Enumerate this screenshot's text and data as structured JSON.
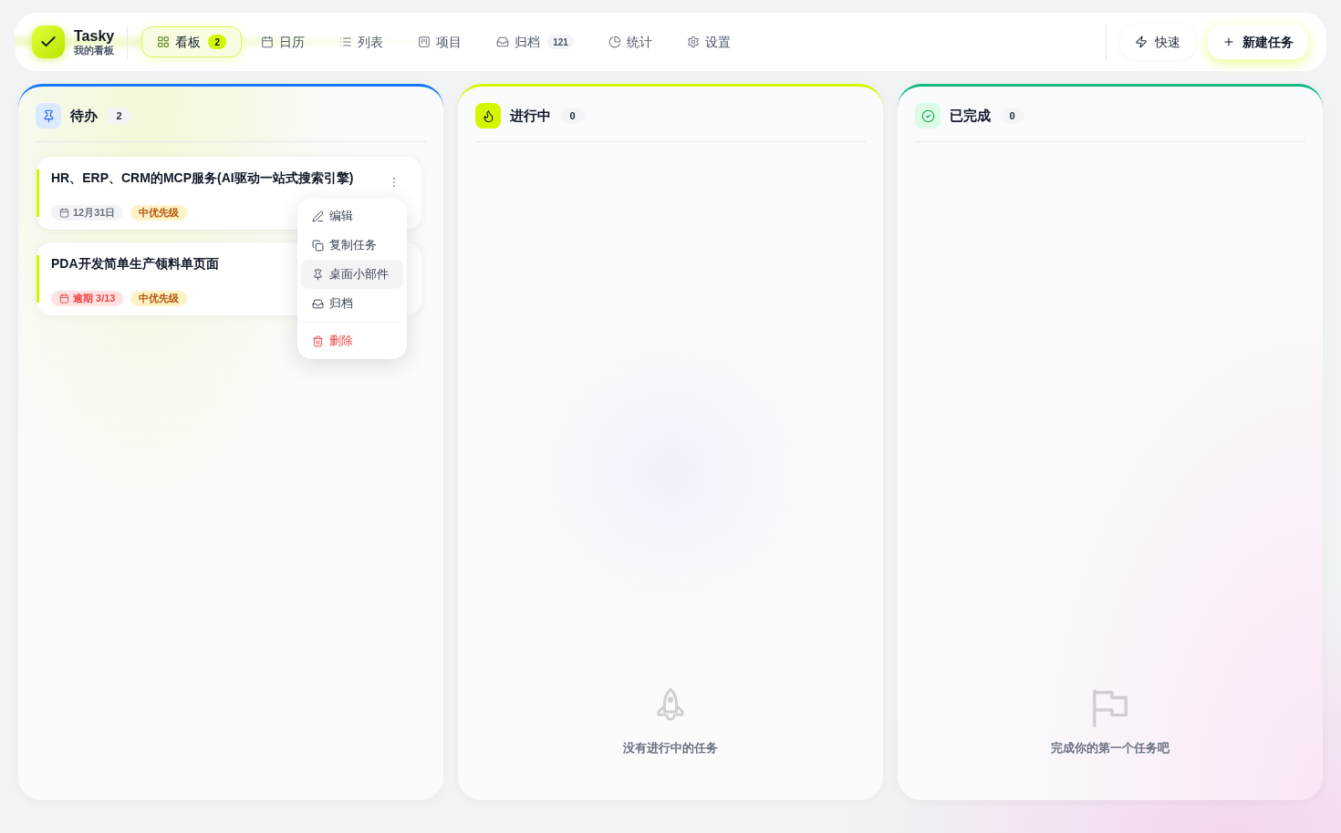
{
  "app": {
    "name": "Tasky",
    "subtitle": "我的看板"
  },
  "nav": [
    {
      "label": "看板",
      "badge": "2",
      "selected": true
    },
    {
      "label": "日历",
      "selected": false
    },
    {
      "label": "列表",
      "selected": false
    },
    {
      "label": "项目",
      "selected": false
    },
    {
      "label": "归档",
      "badge": "121",
      "selected": false
    },
    {
      "label": "统计",
      "selected": false
    },
    {
      "label": "设置",
      "selected": false
    }
  ],
  "actions": [
    {
      "label": "快速",
      "kind": "quick"
    },
    {
      "label": "新建任务",
      "kind": "create"
    }
  ],
  "columns": [
    {
      "title": "待办",
      "count": "2",
      "color": "#1677ff",
      "tasks": [
        {
          "title": "HR、ERP、CRM的MCP服务(AI驱动一站式搜索引擎)",
          "due": {
            "text": "12月31日",
            "overdue": false
          },
          "priority": "中优先级",
          "menu_open": true
        },
        {
          "title": "PDA开发简单生产领料单页面",
          "due": {
            "text": "逾期 3/13",
            "overdue": true
          },
          "priority": "中优先级",
          "menu_open": false
        }
      ]
    },
    {
      "title": "进行中",
      "count": "0",
      "color": "#d4f700",
      "empty_text": "没有进行中的任务"
    },
    {
      "title": "已完成",
      "count": "0",
      "color": "#10b981",
      "empty_text": "完成你的第一个任务吧"
    }
  ],
  "context_menu": {
    "items": [
      {
        "label": "编辑",
        "kind": "normal",
        "selected": false
      },
      {
        "label": "复制任务",
        "kind": "normal",
        "selected": false
      },
      {
        "label": "桌面小部件",
        "kind": "normal",
        "selected": true
      },
      {
        "label": "归档",
        "kind": "normal",
        "selected": false
      },
      {
        "label": "删除",
        "kind": "danger",
        "selected": false
      }
    ]
  }
}
